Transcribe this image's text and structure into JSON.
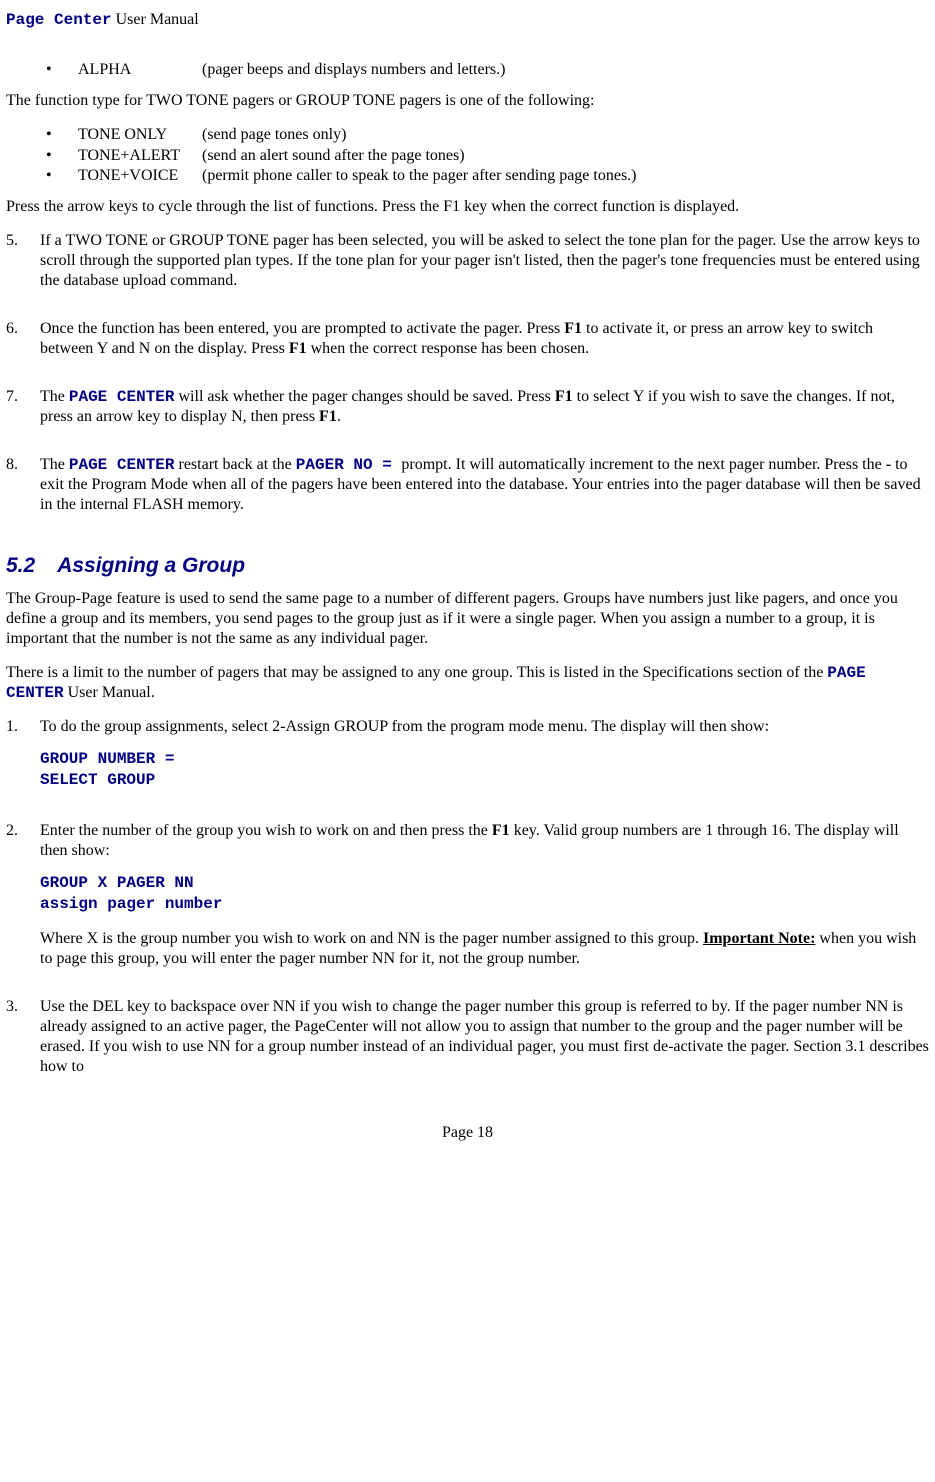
{
  "header": {
    "brand": "Page Center",
    "rest": " User Manual"
  },
  "list1": [
    {
      "term": "ALPHA",
      "desc": "(pager beeps and displays numbers and letters.)"
    }
  ],
  "p_functype": "The function type for TWO TONE pagers or GROUP TONE pagers is one of the following:",
  "list2": [
    {
      "term": "TONE ONLY",
      "desc": "(send page tones only)"
    },
    {
      "term": "TONE+ALERT",
      "desc": "(send an alert sound after the page tones)"
    },
    {
      "term": "TONE+VOICE",
      "desc": "(permit phone caller to speak to the pager after sending page tones.)"
    }
  ],
  "p_arrow": "Press the arrow keys to cycle through the list of functions.  Press the F1 key when the correct function is displayed.",
  "step5": "If a TWO TONE or GROUP TONE pager has been selected, you will be asked to select the tone plan for the pager.  Use the arrow keys to scroll through the supported plan types.  If the tone plan for your pager isn't listed, then the pager's tone frequencies must be entered using the database upload command.",
  "step6": {
    "a": "Once the function has been entered, you are prompted to activate the pager.  Press ",
    "f1a": "F1",
    "b": " to activate it, or press an arrow key to switch between Y and N on the display.  Press ",
    "f1b": "F1",
    "c": " when the correct response has been chosen."
  },
  "step7": {
    "a": "The ",
    "pc": "PAGE CENTER",
    "b": " will ask whether the pager changes should be saved.  Press ",
    "f1a": "F1",
    "c": " to select Y if you wish to save the changes.  If not, press an arrow key to display N, then press ",
    "f1b": "F1",
    "d": "."
  },
  "step8": {
    "a": "The ",
    "pc": "PAGE CENTER",
    "b": " restart back at the ",
    "prompt": "PAGER NO = ",
    "c": "  prompt.  It will automatically increment to the next pager number.   Press the ",
    "dash": "-",
    "d": " to exit the Program Mode when all of the pagers have been entered into the database.  Your entries into the pager database will then be saved in the internal FLASH memory."
  },
  "section": {
    "num": "5.2",
    "title": "Assigning a Group"
  },
  "p_group1": "The Group-Page feature is used to send the same page to a number of different pagers.  Groups have numbers just like pagers, and once you define a group and its members, you send pages to the group just as if it were a single pager.  When you assign a number to a group, it is important that the number is not the same as any individual pager.",
  "p_group2": {
    "a": "There is a limit to the number of pagers that may be assigned to any one group.  This is listed in the Specifications section of the ",
    "pc": "PAGE CENTER",
    "b": " User Manual."
  },
  "g1": {
    "text": "To do the group assignments, select 2-Assign GROUP from the program mode menu.  The display will then show:",
    "code1": "GROUP NUMBER =",
    "code2": "SELECT GROUP"
  },
  "g2": {
    "a": "Enter the number of the group you wish to work on and then press the ",
    "f1": "F1",
    "b": " key.  Valid group numbers are 1 through 16.  The display will then show:",
    "code1": "GROUP  X  PAGER NN",
    "code2": "assign pager number",
    "c": "Where X is the group number you wish to work on and NN is the pager number assigned to this group. ",
    "important": "Important Note:",
    "d": " when you wish to page this group, you will enter the pager number NN for it, not the group number."
  },
  "g3": "Use the DEL key to backspace over NN if you wish to change the pager number this group is referred to by. If the pager number NN is already assigned to an active pager, the PageCenter will not allow you to assign that number to the group and the pager number will be erased.  If you wish to use NN for a group number instead of an individual pager, you must first de-activate the pager. Section 3.1 describes how to",
  "footer": "Page 18"
}
